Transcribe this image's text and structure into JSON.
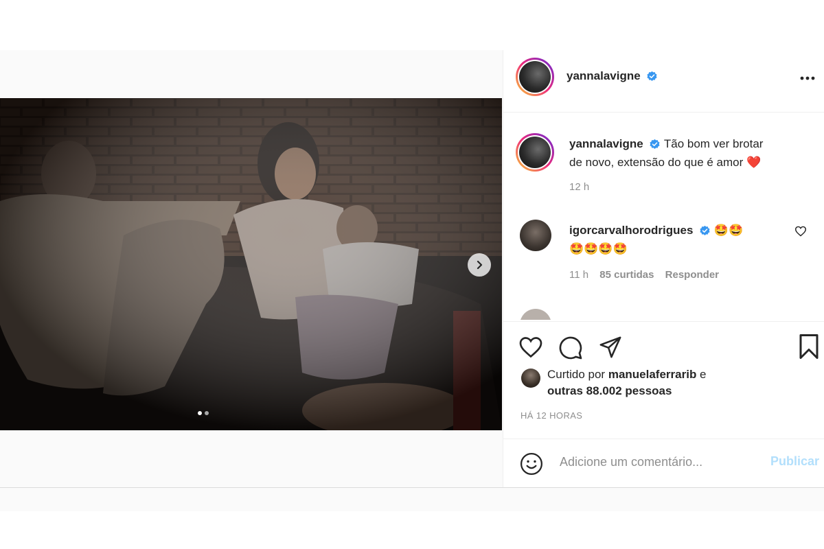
{
  "post": {
    "username": "yannalavigne",
    "more_icon": "more-horizontal-icon",
    "image_alt": "Photo of a family relaxing on a couch in front of a brick wall at night",
    "carousel_dots": 2,
    "carousel_active_index": 0
  },
  "caption": {
    "username": "yannalavigne",
    "text_line1": "Tão bom ver brotar",
    "text_line2": "de novo, extensão do que é amor",
    "emoji": "❤️",
    "time": "12 h"
  },
  "comments": [
    {
      "username": "igorcarvalhorodrigues",
      "text_line1": "🤩🤩",
      "text_line2": "🤩🤩🤩🤩",
      "time": "11 h",
      "likes": "85 curtidas",
      "reply_label": "Responder"
    }
  ],
  "likes": {
    "prefix": "Curtido por ",
    "user": "manuelaferrarib",
    "suffix": " e",
    "others": "outras 88.002 pessoas"
  },
  "timestamp": "HÁ 12 HORAS",
  "comment_box": {
    "placeholder": "Adicione um comentário...",
    "publish_label": "Publicar"
  },
  "colors": {
    "verified": "#3897f0",
    "publish_disabled": "#b2dffc",
    "muted_text": "#8e8e8e"
  }
}
